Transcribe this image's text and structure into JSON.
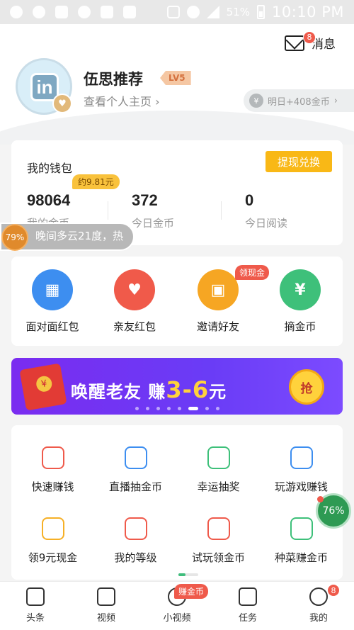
{
  "status_bar": {
    "battery": "51%",
    "time": "10:10 PM"
  },
  "header": {
    "message_badge": "8",
    "message_label": "消息",
    "username": "伍思推荐",
    "level": "LV5",
    "profile_link": "查看个人主页",
    "tomorrow_reward": "明日+408金币"
  },
  "wallet": {
    "title": "我的钱包",
    "withdraw_label": "提现兑换",
    "approx_value": "约9.81元",
    "stats": [
      {
        "value": "98064",
        "label": "我的金币"
      },
      {
        "value": "372",
        "label": "今日金币"
      },
      {
        "value": "0",
        "label": "今日阅读"
      }
    ]
  },
  "weather": {
    "percent": "79%",
    "text": "晚间多云21度，热"
  },
  "quick_actions": {
    "items": [
      {
        "label": "面对面红包",
        "icon": "qr-redpacket-icon",
        "color": "#3d8ef0"
      },
      {
        "label": "亲友红包",
        "icon": "heart-redpacket-icon",
        "color": "#f05a4a"
      },
      {
        "label": "邀请好友",
        "icon": "treasure-chest-icon",
        "color": "#f6a623"
      },
      {
        "label": "摘金币",
        "icon": "pick-coin-icon",
        "color": "#3ec07a"
      }
    ],
    "invite_tag": "领现金"
  },
  "banner": {
    "title_main": "唤醒老友 赚",
    "title_highlight": "3-6",
    "title_unit": "元",
    "grab_label": "抢"
  },
  "tasks": {
    "items": [
      {
        "label": "快速赚钱",
        "icon": "money-bag-icon",
        "color": "#ef5a4b"
      },
      {
        "label": "直播抽金币",
        "icon": "live-video-icon",
        "color": "#3d8ef0"
      },
      {
        "label": "幸运抽奖",
        "icon": "lucky-draw-icon",
        "color": "#3ec07a"
      },
      {
        "label": "玩游戏赚钱",
        "icon": "gamepad-icon",
        "color": "#3d8ef0"
      },
      {
        "label": "领9元现金",
        "icon": "heart-coin-icon",
        "color": "#f6b026"
      },
      {
        "label": "我的等级",
        "icon": "diamond-level-icon",
        "color": "#ef5a4b"
      },
      {
        "label": "试玩领金币",
        "icon": "robot-icon",
        "color": "#ef5a4b"
      },
      {
        "label": "种菜赚金币",
        "icon": "plant-icon",
        "color": "#3ec07a"
      }
    ]
  },
  "speed_float": {
    "percent": "76%"
  },
  "nav": {
    "items": [
      {
        "label": "头条",
        "icon": "news-icon"
      },
      {
        "label": "视频",
        "icon": "video-icon"
      },
      {
        "label": "小视频",
        "icon": "short-video-icon"
      },
      {
        "label": "任务",
        "icon": "task-icon"
      },
      {
        "label": "我的",
        "icon": "profile-icon"
      }
    ],
    "shortvideo_tag": "赚金币",
    "profile_badge": "8"
  }
}
